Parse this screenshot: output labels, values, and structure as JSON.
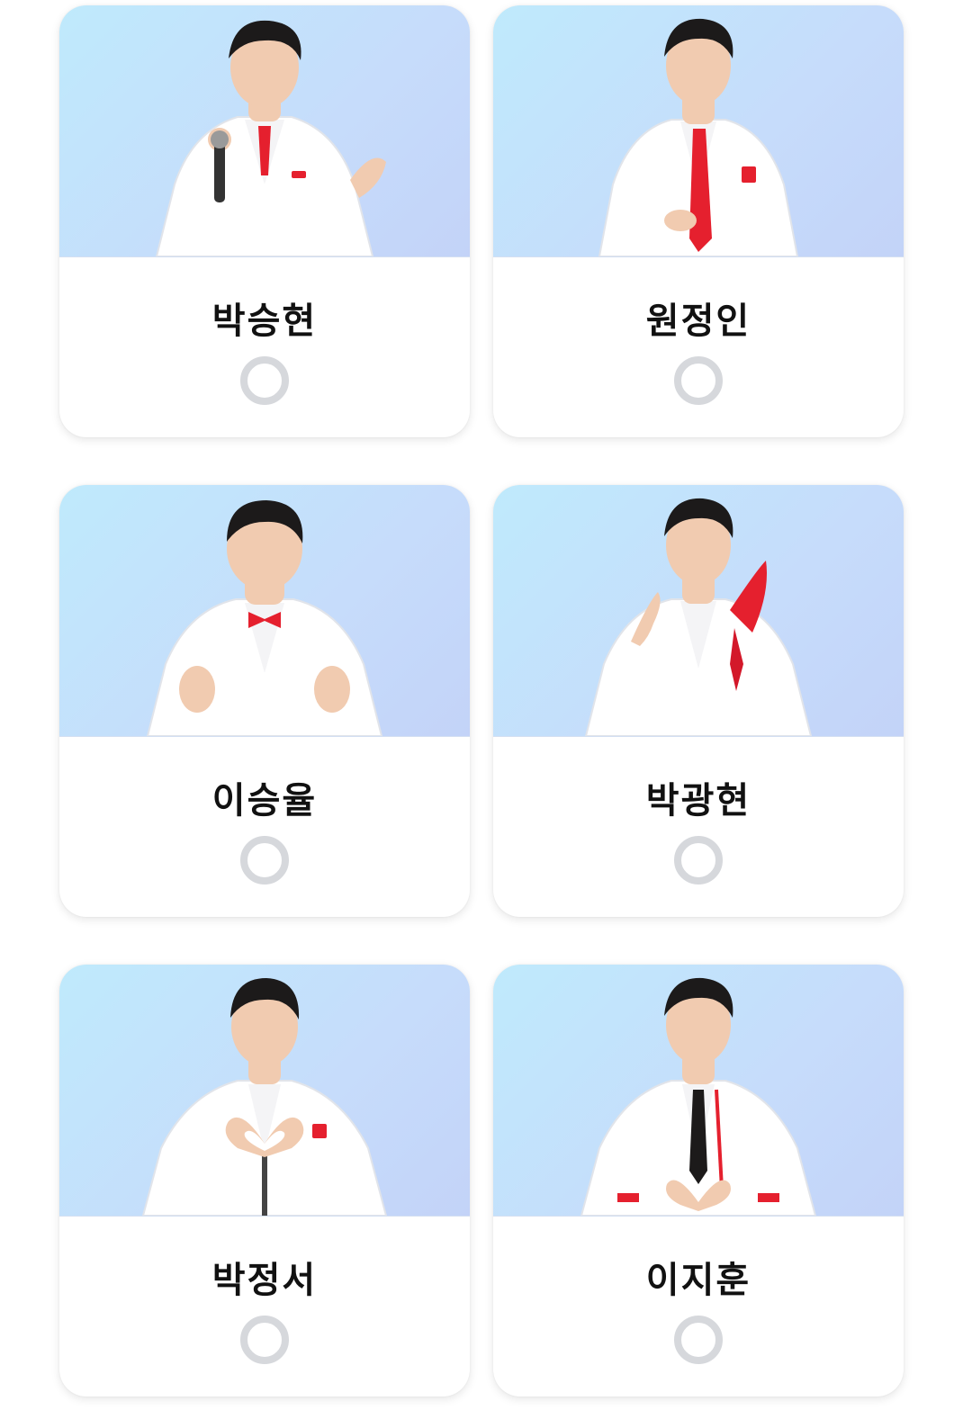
{
  "candidates": [
    {
      "name": "박승현",
      "selected": false,
      "pose": "microphone"
    },
    {
      "name": "원정인",
      "selected": false,
      "pose": "tie"
    },
    {
      "name": "이승율",
      "selected": false,
      "pose": "finger-hearts"
    },
    {
      "name": "박광현",
      "selected": false,
      "pose": "pointing"
    },
    {
      "name": "박정서",
      "selected": false,
      "pose": "heart-hands"
    },
    {
      "name": "이지훈",
      "selected": false,
      "pose": "heart-hands"
    }
  ],
  "colors": {
    "photo_bg_start": "#bfeafc",
    "photo_bg_end": "#c3d3f8",
    "suit": "#ffffff",
    "accent_red": "#e5202e",
    "hair": "#1c1a1a",
    "skin": "#f1cbb0",
    "radio_ring": "#d6d8dc"
  }
}
